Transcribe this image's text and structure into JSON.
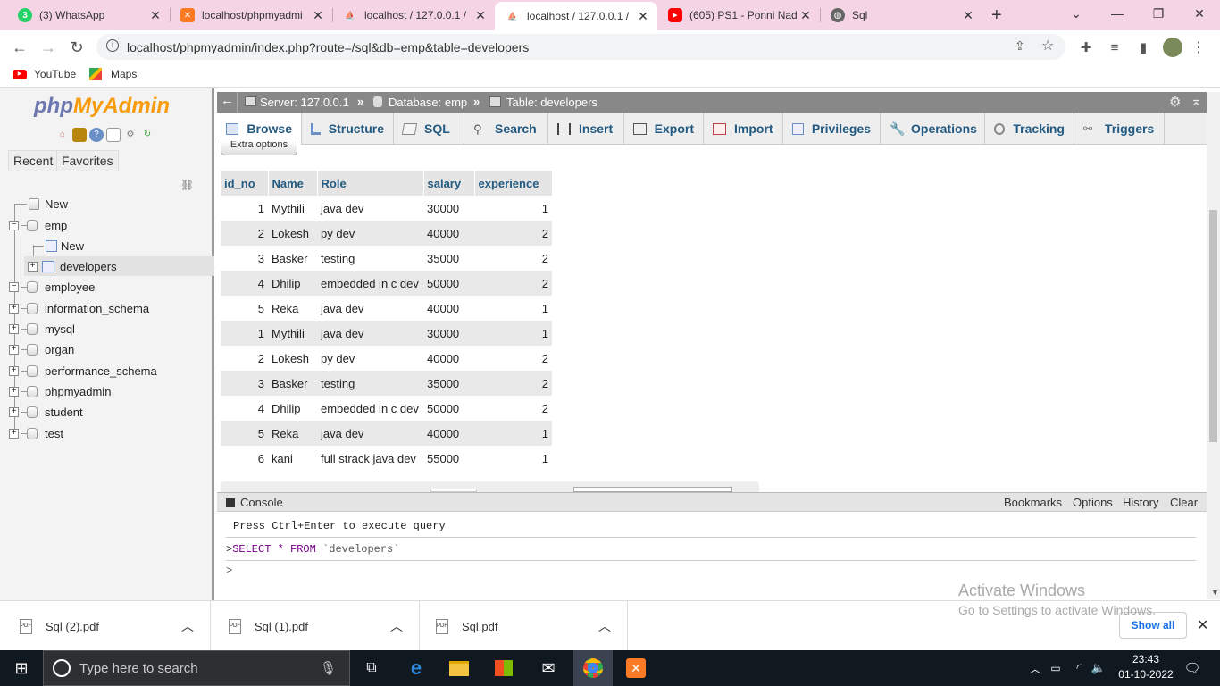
{
  "browser": {
    "tabs": [
      {
        "label": "(3) WhatsApp",
        "icon": "whatsapp-icon",
        "badge": "3"
      },
      {
        "label": "localhost/phpmyadmi",
        "icon": "xampp-icon"
      },
      {
        "label": "localhost / 127.0.0.1 /",
        "icon": "phpmyadmin-icon"
      },
      {
        "label": "localhost / 127.0.0.1 /",
        "icon": "phpmyadmin-icon"
      },
      {
        "label": "(605) PS1 - Ponni Nad",
        "icon": "youtube-icon"
      },
      {
        "label": "Sql",
        "icon": "globe-icon"
      }
    ],
    "url": "localhost/phpmyadmin/index.php?route=/sql&db=emp&table=developers",
    "bookmarks": [
      {
        "label": "YouTube",
        "icon": "youtube-icon"
      },
      {
        "label": "Maps",
        "icon": "maps-icon"
      }
    ]
  },
  "sidebar": {
    "logo_php": "php",
    "logo_myadmin": "MyAdmin",
    "tabs": [
      "Recent",
      "Favorites"
    ],
    "tree": {
      "new_top": "New",
      "emp": "emp",
      "emp_new": "New",
      "developers": "developers",
      "databases": [
        "employee",
        "information_schema",
        "mysql",
        "organ",
        "performance_schema",
        "phpmyadmin",
        "student",
        "test"
      ]
    }
  },
  "breadcrumb": {
    "server": "Server: 127.0.0.1",
    "database": "Database: emp",
    "table": "Table: developers"
  },
  "main_tabs": [
    "Browse",
    "Structure",
    "SQL",
    "Search",
    "Insert",
    "Export",
    "Import",
    "Privileges",
    "Operations",
    "Tracking",
    "Triggers"
  ],
  "extra_options": "Extra options",
  "results": {
    "columns": [
      "id_no",
      "Name",
      "Role",
      "salary",
      "experience"
    ],
    "rows": [
      [
        "1",
        "Mythili",
        "java dev",
        "30000",
        "1"
      ],
      [
        "2",
        "Lokesh",
        "py dev",
        "40000",
        "2"
      ],
      [
        "3",
        "Basker",
        "testing",
        "35000",
        "2"
      ],
      [
        "4",
        "Dhilip",
        "embedded in c dev",
        "50000",
        "2"
      ],
      [
        "5",
        "Reka",
        "java dev",
        "40000",
        "1"
      ],
      [
        "1",
        "Mythili",
        "java dev",
        "30000",
        "1"
      ],
      [
        "2",
        "Lokesh",
        "py dev",
        "40000",
        "2"
      ],
      [
        "3",
        "Basker",
        "testing",
        "35000",
        "2"
      ],
      [
        "4",
        "Dhilip",
        "embedded in c dev",
        "50000",
        "2"
      ],
      [
        "5",
        "Reka",
        "java dev",
        "40000",
        "1"
      ],
      [
        "6",
        "kani",
        "full strack java dev",
        "55000",
        "1"
      ]
    ]
  },
  "console": {
    "title": "Console",
    "buttons": [
      "Bookmarks",
      "Options",
      "History",
      "Clear"
    ],
    "hint": "Press Ctrl+Enter to execute query",
    "last_query_prompt": ">",
    "last_query_kw1": "SELECT",
    "last_query_star": "*",
    "last_query_kw2": "FROM",
    "last_query_table": "`developers`",
    "input_prompt": ">"
  },
  "downloads": {
    "items": [
      "Sql (2).pdf",
      "Sql (1).pdf",
      "Sql.pdf"
    ],
    "show_all": "Show all"
  },
  "watermark": {
    "line1": "Activate Windows",
    "line2": "Go to Settings to activate Windows."
  },
  "taskbar": {
    "search_placeholder": "Type here to search",
    "time": "23:43",
    "date": "01-10-2022"
  }
}
